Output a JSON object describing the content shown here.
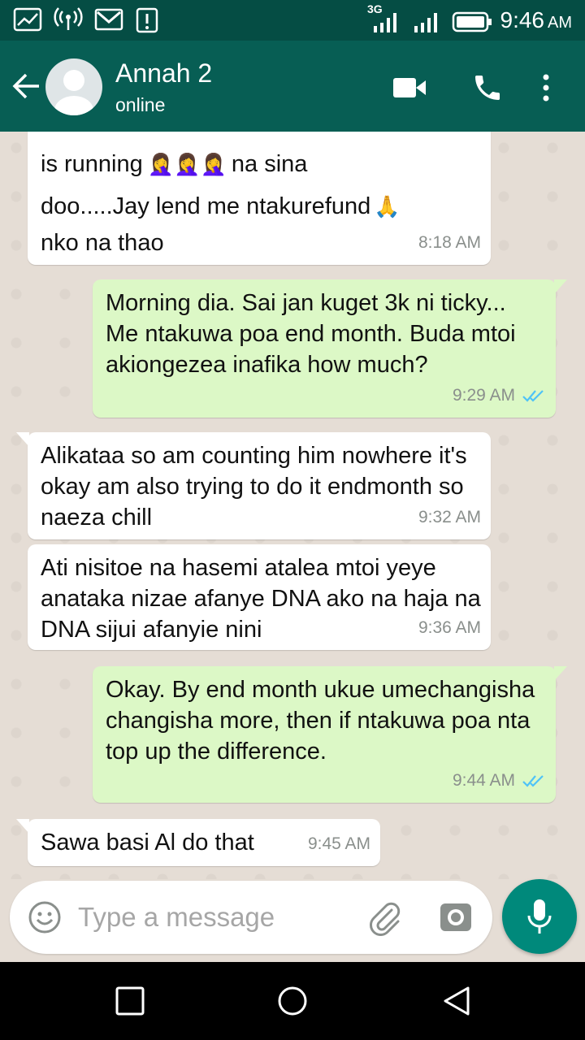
{
  "status_bar": {
    "network_label": "3G",
    "time": "9:46",
    "ampm": "AM",
    "icons": [
      "chart-icon",
      "hotspot-icon",
      "gmail-icon",
      "alert-icon",
      "signal-icon",
      "signal-icon",
      "battery-icon"
    ]
  },
  "header": {
    "contact_name": "Annah 2",
    "contact_status": "online",
    "icons": [
      "back-arrow-icon",
      "avatar-icon",
      "video-call-icon",
      "voice-call-icon",
      "more-vert-icon"
    ]
  },
  "messages": [
    {
      "direction": "in",
      "text_line1": "is running",
      "emojis1": "🤦‍♀️🤦‍♀️🤦‍♀️",
      "text_line1b": "na sina",
      "text_line2": "doo.....Jay lend me ntakurefund",
      "emoji2": "🙏",
      "text_line3": "nko na thao",
      "time": "8:18 AM"
    },
    {
      "direction": "out",
      "text": "Morning dia. Sai jan kuget 3k ni ticky... Me ntakuwa poa end month. Buda mtoi akiongezea inafika how much?",
      "time": "9:29 AM",
      "status": "read"
    },
    {
      "direction": "in",
      "text": "Alikataa so am counting him nowhere it's okay am also trying to do it endmonth so naeza chill",
      "time": "9:32 AM"
    },
    {
      "direction": "in",
      "text": "Ati nisitoe na hasemi atalea mtoi yeye anataka nizae afanye DNA ako na haja na DNA sijui afanyie nini",
      "time": "9:36 AM"
    },
    {
      "direction": "out",
      "text": "Okay. By end month ukue umechangisha changisha more, then if ntakuwa poa nta top up the difference.",
      "time": "9:44 AM",
      "status": "read"
    },
    {
      "direction": "in",
      "text": "Sawa basi Al do that",
      "time": "9:45 AM"
    }
  ],
  "composer": {
    "placeholder": "Type a message",
    "icons": [
      "emoji-icon",
      "attachment-icon",
      "camera-icon",
      "mic-icon"
    ]
  },
  "nav_bar": {
    "icons": [
      "recents-icon",
      "home-icon",
      "back-icon"
    ]
  },
  "colors": {
    "header": "#075e54",
    "status_bar": "#054d44",
    "outgoing_bubble": "#dcf8c6",
    "incoming_bubble": "#ffffff",
    "chat_bg": "#e5ddd5",
    "accent": "#00897b",
    "read_tick": "#4fc3f7"
  }
}
